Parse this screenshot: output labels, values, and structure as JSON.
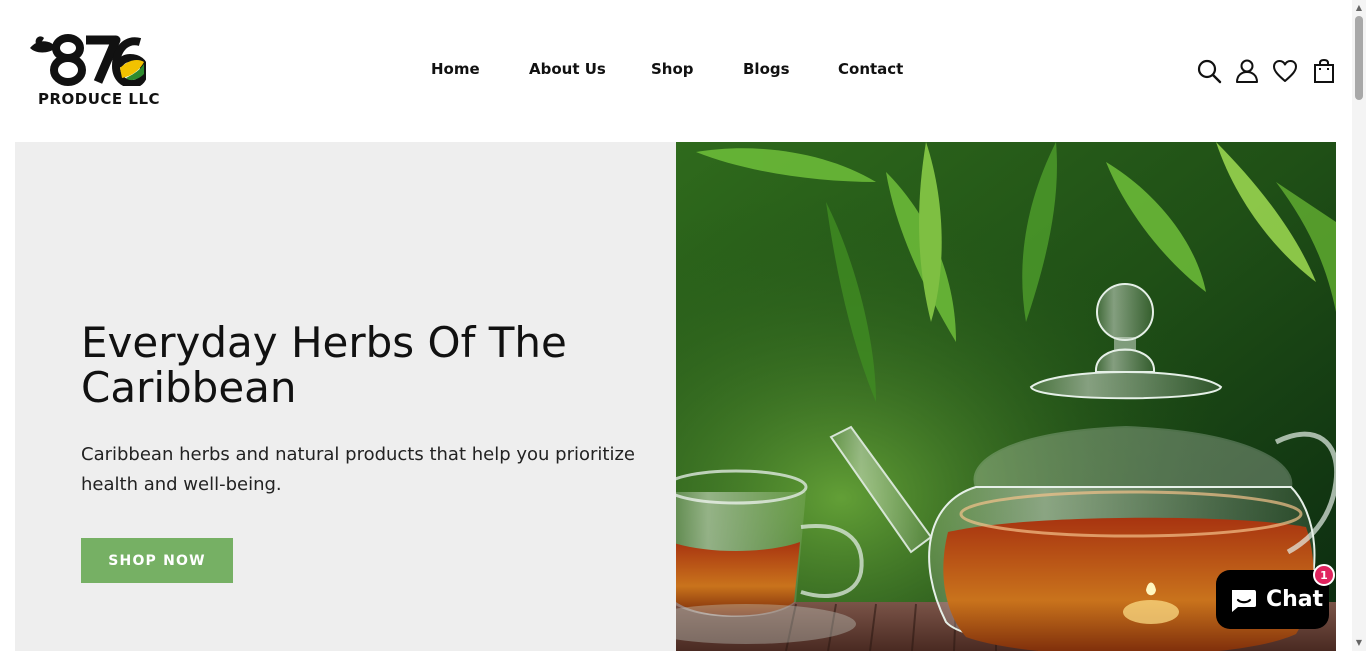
{
  "brand": {
    "logo_mark": "876",
    "logo_text": "PRODUCE LLC",
    "colors": {
      "leaf_green": "#2e8b2e",
      "flag_yellow": "#f2c200",
      "black": "#111111"
    }
  },
  "nav": {
    "items": [
      {
        "label": "Home"
      },
      {
        "label": "About Us"
      },
      {
        "label": "Shop"
      },
      {
        "label": "Blogs"
      },
      {
        "label": "Contact"
      }
    ]
  },
  "header_icons": [
    "search-icon",
    "account-icon",
    "wishlist-heart-icon",
    "cart-bag-icon"
  ],
  "hero": {
    "title": "Everyday Herbs Of The Caribbean",
    "subtitle": "Caribbean herbs and natural products that help you prioritize health and well-being.",
    "cta_label": "SHOP NOW",
    "cta_color": "#76b064",
    "panel_color": "#eeeeee"
  },
  "chat": {
    "label": "Chat",
    "badge_count": "1",
    "badge_color": "#e0245e"
  }
}
